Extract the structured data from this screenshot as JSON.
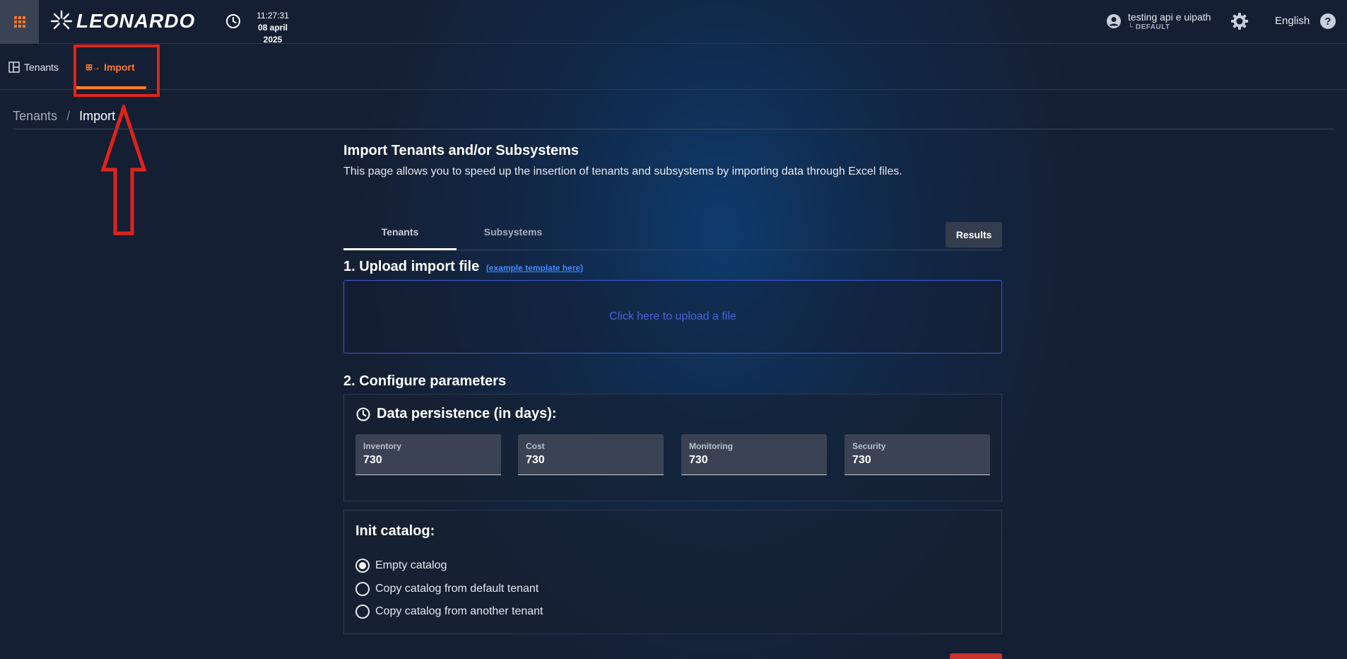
{
  "header": {
    "brand": "LEONARDO",
    "time": "11:27:31",
    "date": "08 april 2025",
    "user_name": "testing api e uipath",
    "user_tenant": "└ DEFAULT",
    "language": "English",
    "icons": [
      "apps-grid-icon",
      "clock-icon",
      "user-icon",
      "theme-gear-icon",
      "help-icon"
    ]
  },
  "nav": {
    "tenants_label": "Tenants",
    "import_label": "Import",
    "import_icon_glyph": "⊞→"
  },
  "breadcrumb": {
    "parent": "Tenants",
    "separator": "/",
    "current": "Import"
  },
  "page": {
    "title": "Import Tenants and/or Subsystems",
    "description": "This page allows you to speed up the insertion of tenants and subsystems by importing data through Excel files."
  },
  "tabs": [
    {
      "label": "Tenants",
      "active": true
    },
    {
      "label": "Subsystems",
      "active": false
    }
  ],
  "results_label": "Results",
  "upload": {
    "heading": "1. Upload import file",
    "template_link": "(example template here)",
    "prompt": "Click here to upload a file"
  },
  "config": {
    "heading": "2. Configure parameters",
    "persistence_title": "Data persistence (in days):",
    "fields": [
      {
        "label": "Inventory",
        "value": "730"
      },
      {
        "label": "Cost",
        "value": "730"
      },
      {
        "label": "Monitoring",
        "value": "730"
      },
      {
        "label": "Security",
        "value": "730"
      }
    ]
  },
  "catalog": {
    "title": "Init catalog:",
    "options": [
      {
        "label": "Empty catalog",
        "selected": true
      },
      {
        "label": "Copy catalog from default tenant",
        "selected": false
      },
      {
        "label": "Copy catalog from another tenant",
        "selected": false
      }
    ]
  },
  "colors": {
    "accent": "#ff7a2e",
    "annotation_red": "#e2231a",
    "link_blue": "#3d8bff",
    "upload_border": "#3f56d6"
  }
}
